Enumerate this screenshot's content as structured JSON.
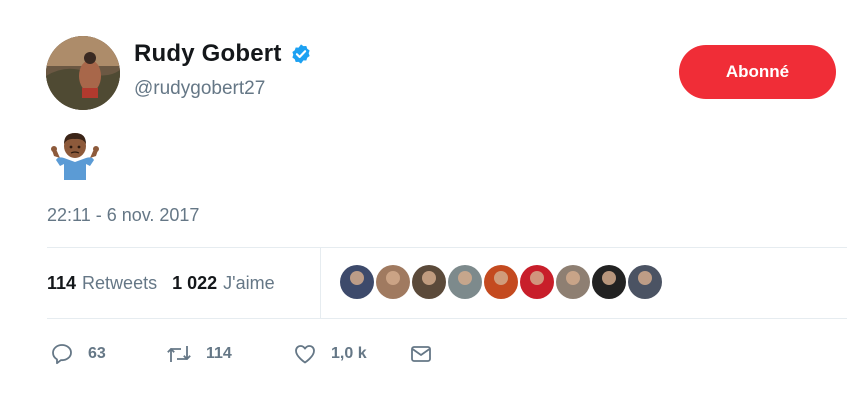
{
  "user": {
    "name": "Rudy Gobert",
    "handle": "@rudygobert27",
    "verified": true
  },
  "follow_button": {
    "label": "Abonné",
    "color": "#f02d37"
  },
  "tweet": {
    "emoji": "person-shrugging-medium-dark-skin",
    "timestamp": "22:11 - 6 nov. 2017"
  },
  "stats": {
    "retweets": {
      "count": "114",
      "label": "Retweets"
    },
    "likes": {
      "count": "1 022",
      "label": "J'aime"
    }
  },
  "likers": [
    {
      "name": "liker-1",
      "color": "#3d4a6b"
    },
    {
      "name": "liker-2",
      "color": "#a07a60"
    },
    {
      "name": "liker-3",
      "color": "#5b4a3a"
    },
    {
      "name": "liker-4",
      "color": "#7d8a8c"
    },
    {
      "name": "liker-5",
      "color": "#c44a1f"
    },
    {
      "name": "liker-6",
      "color": "#c81e2a"
    },
    {
      "name": "liker-7",
      "color": "#8e7f72"
    },
    {
      "name": "liker-8",
      "color": "#222222"
    },
    {
      "name": "liker-9",
      "color": "#4b5363"
    }
  ],
  "actions": {
    "reply": {
      "icon": "reply-icon",
      "count": "63"
    },
    "retweet": {
      "icon": "retweet-icon",
      "count": "114"
    },
    "like": {
      "icon": "heart-icon",
      "count": "1,0 k"
    },
    "message": {
      "icon": "envelope-icon"
    }
  },
  "colors": {
    "text_primary": "#14171a",
    "text_secondary": "#657786",
    "verified_blue": "#1da1f2",
    "divider": "#e6ecf0"
  }
}
